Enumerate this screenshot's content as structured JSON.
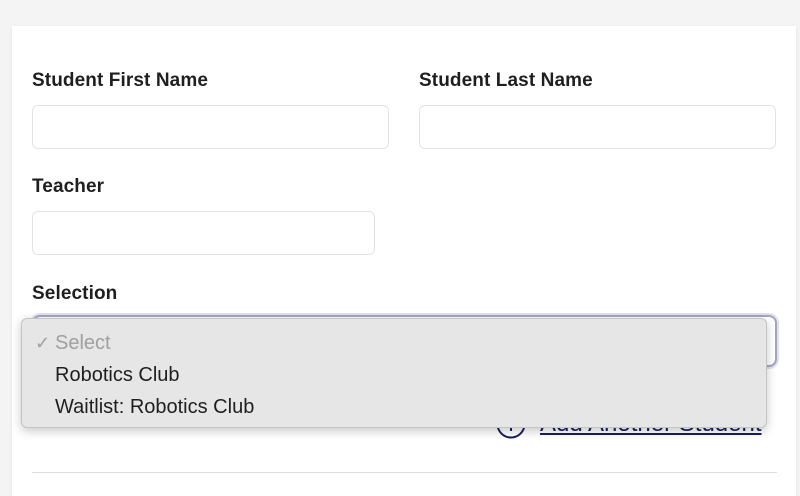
{
  "form": {
    "first_name_label": "Student First Name",
    "first_name_value": "",
    "last_name_label": "Student Last Name",
    "last_name_value": "",
    "teacher_label": "Teacher",
    "teacher_value": "",
    "selection_label": "Selection",
    "add_student_label": "Add Another Student"
  },
  "dropdown": {
    "check_glyph": "✓",
    "options": [
      {
        "label": "Select",
        "selected": true,
        "placeholder": true
      },
      {
        "label": "Robotics Club",
        "selected": false
      },
      {
        "label": "Waitlist: Robotics Club",
        "selected": false
      }
    ]
  },
  "colors": {
    "link": "#1a1f5e",
    "focus_ring": "#a4a4c4"
  }
}
